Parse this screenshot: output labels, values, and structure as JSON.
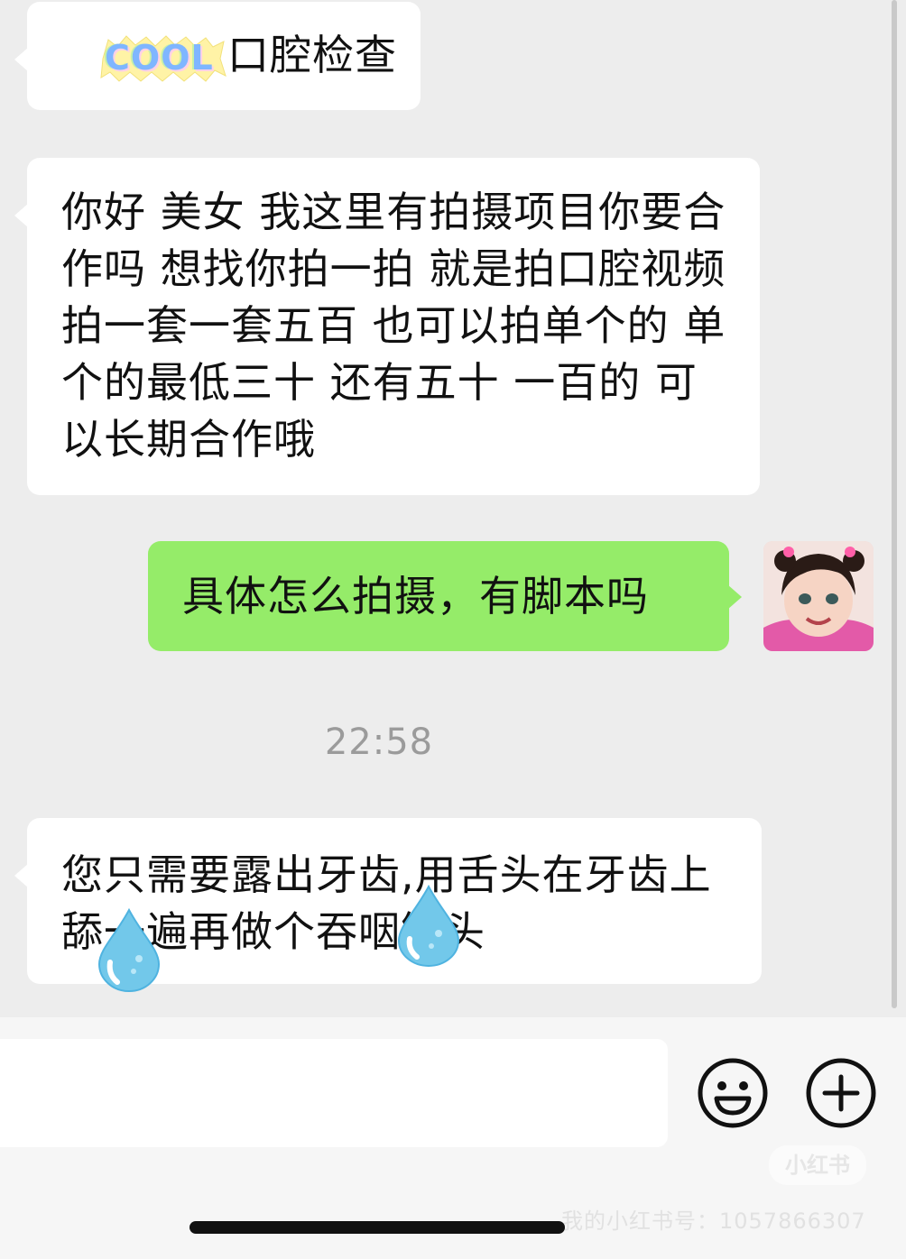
{
  "messages": [
    {
      "id": "msg1",
      "direction": "incoming",
      "sticker_text": "COOL",
      "text": "口腔检查"
    },
    {
      "id": "msg2",
      "direction": "incoming",
      "text": "你好 美女 我这里有拍摄项目你要合作吗 想找你拍一拍 就是拍口腔视频拍一套一套五百 也可以拍单个的 单个的最低三十 还有五十 一百的 可以长期合作哦"
    },
    {
      "id": "msg3",
      "direction": "outgoing",
      "text": "具体怎么拍摄，有脚本吗"
    },
    {
      "id": "msg4",
      "direction": "incoming",
      "text": "您只需要露出牙齿,用舌头在牙齿上舔一遍再做个吞咽镜头"
    }
  ],
  "timestamp": "22:58",
  "input": {
    "placeholder": "",
    "value": ""
  },
  "icons": {
    "emoji": "emoji-smile-icon",
    "more": "plus-circle-icon",
    "avatar": "user-avatar-photo",
    "drops": "water-drop-sticker"
  },
  "colors": {
    "background": "#ededed",
    "incoming_bubble": "#ffffff",
    "outgoing_bubble": "#95ec69",
    "timestamp": "#9b9b9b"
  },
  "watermark": {
    "logo": "小红书",
    "account": "我的小红书号：1057866307"
  }
}
